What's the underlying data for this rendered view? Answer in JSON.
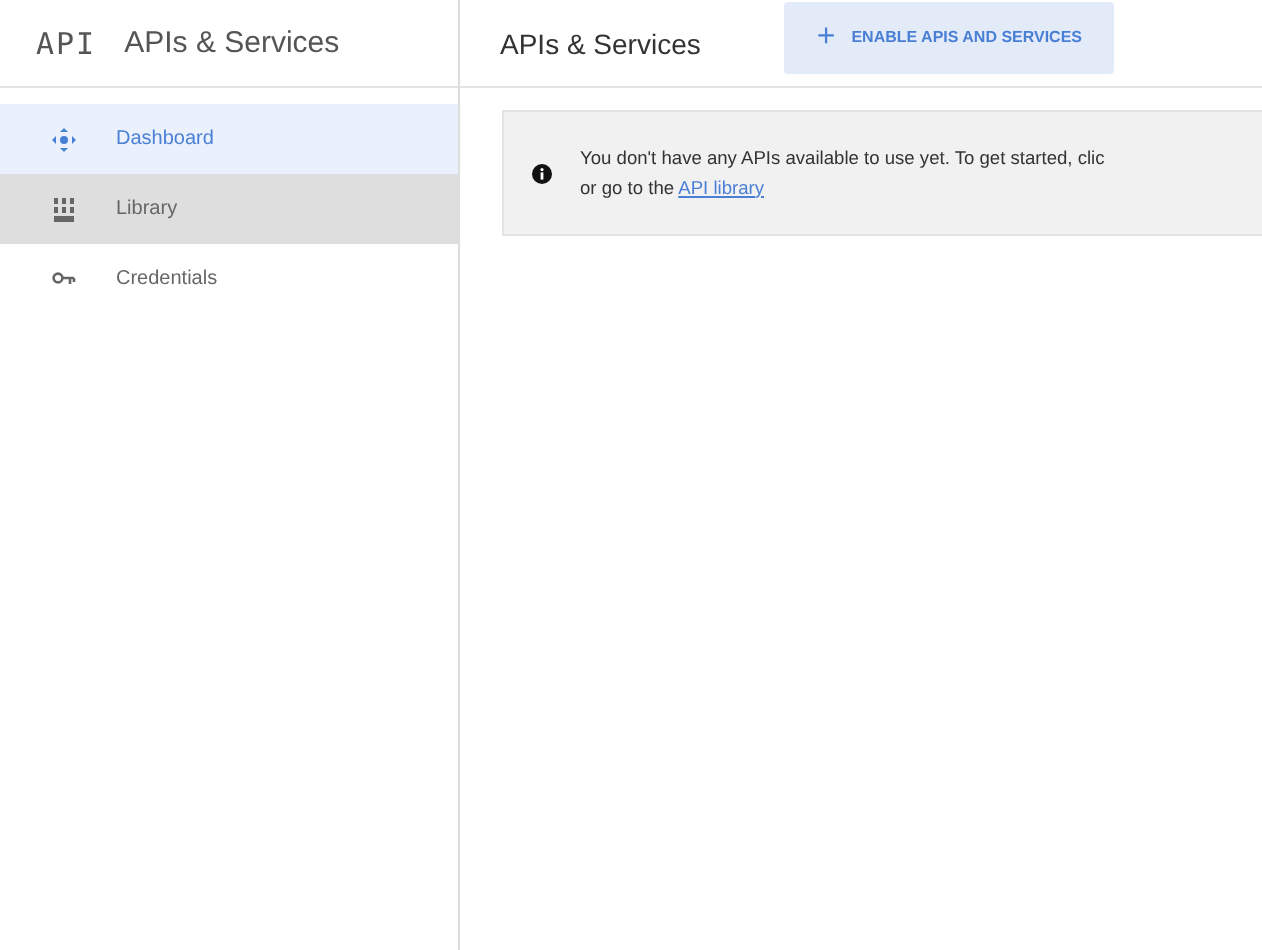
{
  "sidebar": {
    "logo": "API",
    "title": "APIs & Services",
    "items": [
      {
        "label": "Dashboard",
        "kind": "dashboard",
        "selected": true,
        "hovered": false
      },
      {
        "label": "Library",
        "kind": "library",
        "selected": false,
        "hovered": true
      },
      {
        "label": "Credentials",
        "kind": "key",
        "selected": false,
        "hovered": false
      }
    ]
  },
  "header": {
    "title": "APIs & Services",
    "action": {
      "icon": "+",
      "label": "ENABLE APIS AND SERVICES"
    }
  },
  "banner": {
    "line_1": "You don't have any APIs available to use yet. To get started, clic",
    "line_2": "or go to the",
    "link": "API library"
  }
}
